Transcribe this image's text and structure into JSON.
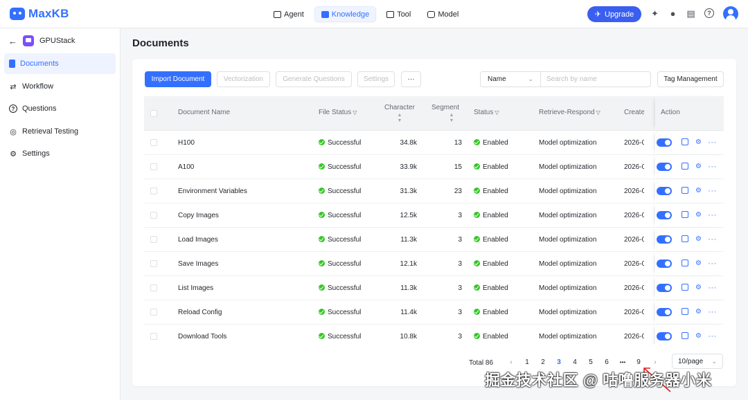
{
  "app": {
    "name": "MaxKB"
  },
  "topnav": [
    {
      "label": "Agent",
      "icon": "robot-icon",
      "active": false
    },
    {
      "label": "Knowledge",
      "icon": "book-icon",
      "active": true
    },
    {
      "label": "Tool",
      "icon": "toolbox-icon",
      "active": false
    },
    {
      "label": "Model",
      "icon": "cube-icon",
      "active": false
    }
  ],
  "header": {
    "upgrade_label": "Upgrade"
  },
  "sidebar": {
    "kb_name": "GPUStack",
    "items": [
      {
        "label": "Documents",
        "active": true
      },
      {
        "label": "Workflow",
        "active": false
      },
      {
        "label": "Questions",
        "active": false
      },
      {
        "label": "Retrieval Testing",
        "active": false
      },
      {
        "label": "Settings",
        "active": false
      }
    ]
  },
  "page": {
    "title": "Documents"
  },
  "toolbar": {
    "import": "Import Document",
    "vectorization": "Vectorization",
    "generate": "Generate Questions",
    "settings": "Settings",
    "more": "···",
    "filter_select": "Name",
    "search_placeholder": "Search by name",
    "tag_management": "Tag Management"
  },
  "table": {
    "columns": {
      "name": "Document Name",
      "file_status": "File Status",
      "character": "Character",
      "segment": "Segment",
      "status": "Status",
      "retrieve": "Retrieve-Respond",
      "create": "Create",
      "action": "Action"
    },
    "rows": [
      {
        "name": "H100",
        "file_status": "Successful",
        "character": "34.8k",
        "segment": "13",
        "status": "Enabled",
        "retrieve": "Model optimization",
        "create": "2026-0"
      },
      {
        "name": "A100",
        "file_status": "Successful",
        "character": "33.9k",
        "segment": "15",
        "status": "Enabled",
        "retrieve": "Model optimization",
        "create": "2026-0"
      },
      {
        "name": "Environment Variables",
        "file_status": "Successful",
        "character": "31.3k",
        "segment": "23",
        "status": "Enabled",
        "retrieve": "Model optimization",
        "create": "2026-0"
      },
      {
        "name": "Copy Images",
        "file_status": "Successful",
        "character": "12.5k",
        "segment": "3",
        "status": "Enabled",
        "retrieve": "Model optimization",
        "create": "2026-0"
      },
      {
        "name": "Load Images",
        "file_status": "Successful",
        "character": "11.3k",
        "segment": "3",
        "status": "Enabled",
        "retrieve": "Model optimization",
        "create": "2026-0"
      },
      {
        "name": "Save Images",
        "file_status": "Successful",
        "character": "12.1k",
        "segment": "3",
        "status": "Enabled",
        "retrieve": "Model optimization",
        "create": "2026-0"
      },
      {
        "name": "List Images",
        "file_status": "Successful",
        "character": "11.3k",
        "segment": "3",
        "status": "Enabled",
        "retrieve": "Model optimization",
        "create": "2026-0"
      },
      {
        "name": "Reload Config",
        "file_status": "Successful",
        "character": "11.4k",
        "segment": "3",
        "status": "Enabled",
        "retrieve": "Model optimization",
        "create": "2026-0"
      },
      {
        "name": "Download Tools",
        "file_status": "Successful",
        "character": "10.8k",
        "segment": "3",
        "status": "Enabled",
        "retrieve": "Model optimization",
        "create": "2026-0"
      }
    ]
  },
  "pagination": {
    "total": "Total 86",
    "pages": [
      "1",
      "2",
      "3",
      "4",
      "5",
      "6",
      "•••",
      "9"
    ],
    "current": "3",
    "page_size": "10/page"
  },
  "watermark": "掘金技术社区 @ 咕噜服务器小米",
  "colors": {
    "primary": "#3370ff",
    "success": "#34c724",
    "upgrade": "#3a5ff0"
  }
}
